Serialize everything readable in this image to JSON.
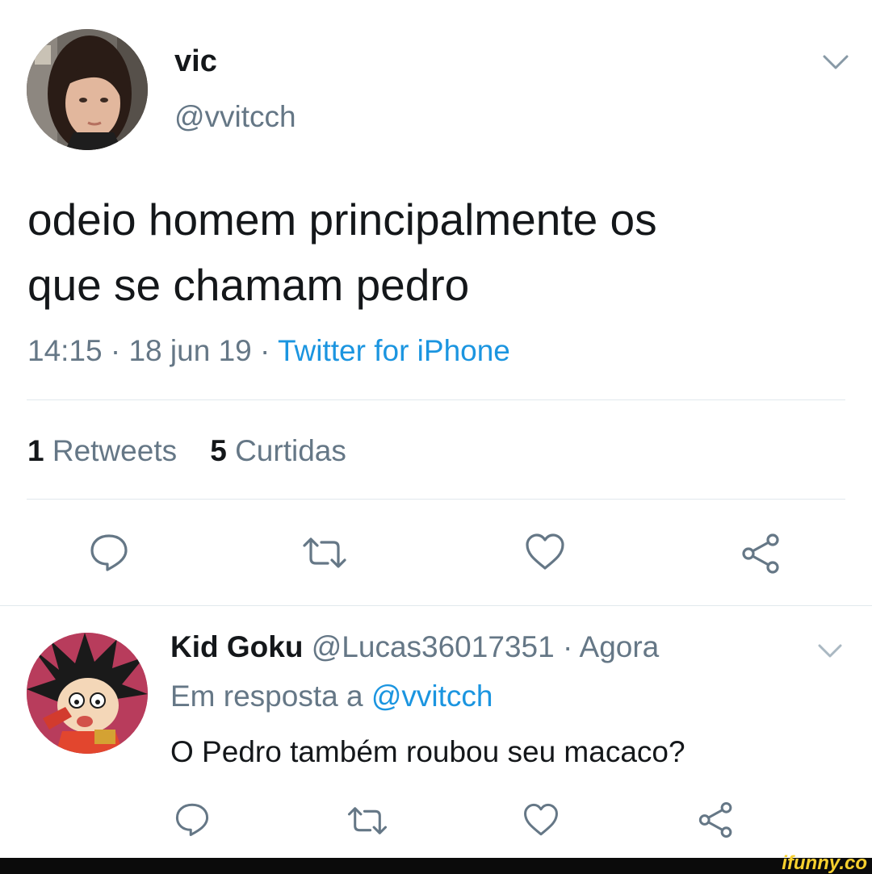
{
  "tweet": {
    "display_name": "vic",
    "handle": "@vvitcch",
    "text_line1": "odeio homem principalmente os",
    "text_line2": "que se chamam pedro",
    "time": "14:15",
    "date": "18 jun 19",
    "source": "Twitter for iPhone",
    "retweets_count": "1",
    "retweets_label": "Retweets",
    "likes_count": "5",
    "likes_label": "Curtidas"
  },
  "reply": {
    "display_name": "Kid Goku",
    "handle": "@Lucas36017351",
    "time": "Agora",
    "replying_to_label": "Em resposta a",
    "replying_to_handle": "@vvitcch",
    "text": "O Pedro também roubou seu macaco?"
  },
  "separator": "·",
  "watermark": "ifunny.co",
  "icons": [
    "caret-down-icon",
    "reply-icon",
    "retweet-icon",
    "like-icon",
    "share-icon"
  ],
  "colors": {
    "link_blue": "#1b95e0",
    "secondary_gray": "#657786",
    "icon_gray": "#657786",
    "divider": "#e1e8ed"
  }
}
